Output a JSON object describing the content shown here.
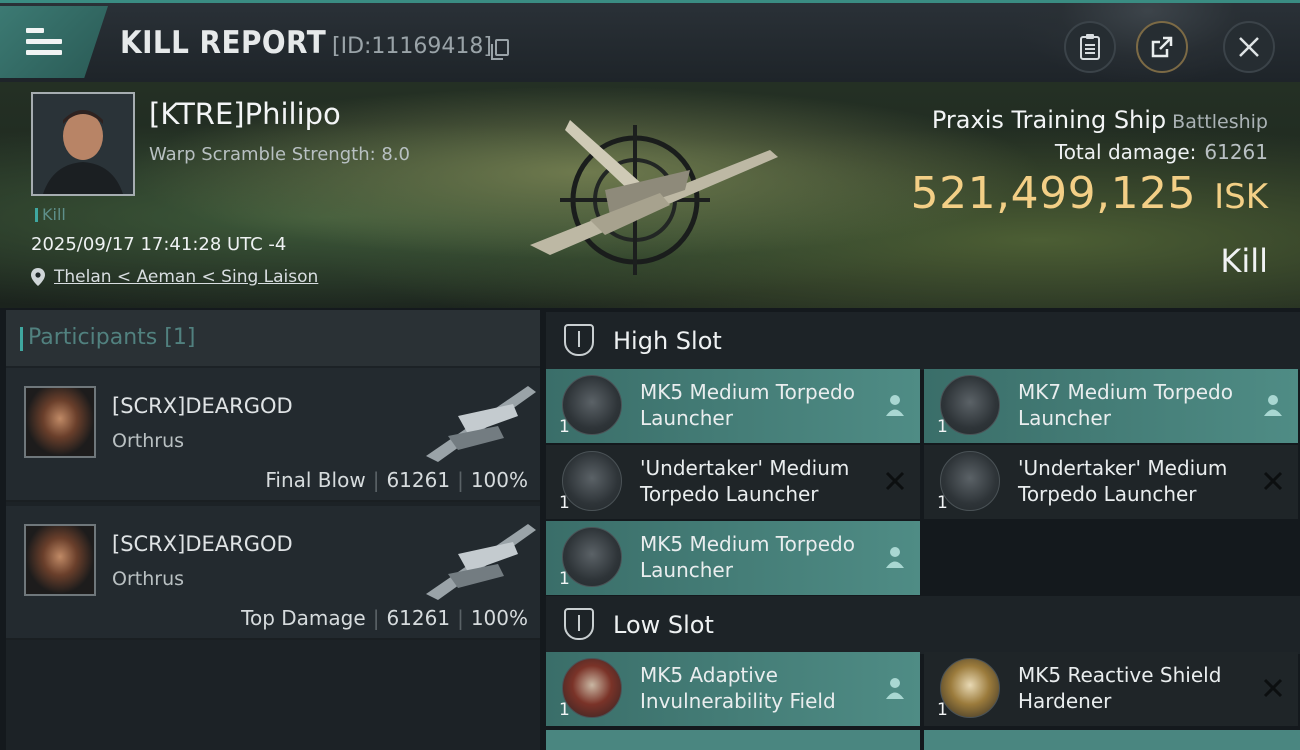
{
  "header": {
    "title": "KILL REPORT",
    "report_id": "[ID:11169418]"
  },
  "victim": {
    "pilot_name": "[KTRE]Philipo",
    "warp_scramble": "Warp Scramble Strength: 8.0",
    "tag": "Kill",
    "datetime": "2025/09/17 17:41:28 UTC -4",
    "location": "Thelan < Aeman < Sing Laison",
    "ship_name": "Praxis Training Ship",
    "ship_class": "Battleship",
    "total_damage_label": "Total damage:",
    "total_damage_value": "61261",
    "isk_value": "521,499,125",
    "isk_unit": "ISK",
    "result": "Kill"
  },
  "participants": {
    "label": "Participants",
    "count": "[1]",
    "items": [
      {
        "name": "[SCRX]DEARGOD",
        "ship": "Orthrus",
        "role": "Final Blow",
        "damage": "61261",
        "percent": "100%"
      },
      {
        "name": "[SCRX]DEARGOD",
        "ship": "Orthrus",
        "role": "Top Damage",
        "damage": "61261",
        "percent": "100%"
      }
    ]
  },
  "slots": {
    "high": {
      "label": "High Slot",
      "modules": [
        {
          "qty": "1",
          "name": "MK5 Medium Torpedo Launcher",
          "status": "fitted"
        },
        {
          "qty": "1",
          "name": "MK7 Medium Torpedo Launcher",
          "status": "fitted"
        },
        {
          "qty": "1",
          "name": "'Undertaker' Medium Torpedo Launcher",
          "status": "destroyed"
        },
        {
          "qty": "1",
          "name": "'Undertaker' Medium Torpedo Launcher",
          "status": "destroyed"
        },
        {
          "qty": "1",
          "name": "MK5 Medium Torpedo Launcher",
          "status": "fitted"
        }
      ]
    },
    "low": {
      "label": "Low Slot",
      "modules": [
        {
          "qty": "1",
          "name": "MK5 Adaptive Invulnerability Field",
          "status": "fitted"
        },
        {
          "qty": "1",
          "name": "MK5 Reactive Shield Hardener",
          "status": "destroyed"
        }
      ]
    }
  },
  "colors": {
    "accent": "#3fa7a0",
    "isk": "#f3cf86",
    "module_active": "#4f8c85",
    "module_destroyed": "#1f2528"
  }
}
